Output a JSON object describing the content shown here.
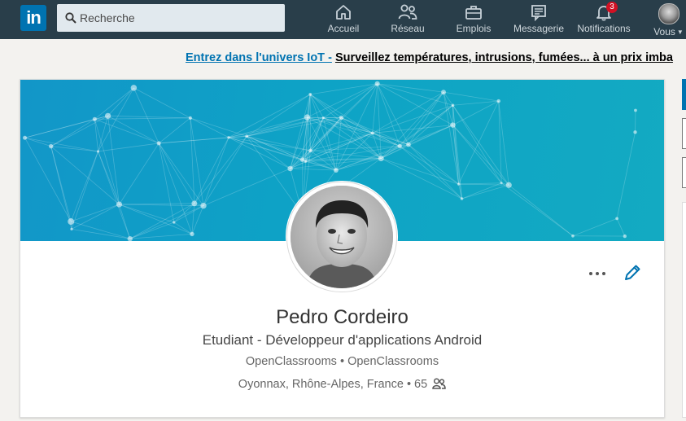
{
  "nav": {
    "logo_text": "in",
    "search": {
      "placeholder": "Recherche",
      "value": ""
    },
    "items": [
      {
        "label": "Accueil",
        "icon": "home-icon"
      },
      {
        "label": "Réseau",
        "icon": "network-icon"
      },
      {
        "label": "Emplois",
        "icon": "briefcase-icon"
      },
      {
        "label": "Messagerie",
        "icon": "messaging-icon"
      },
      {
        "label": "Notifications",
        "icon": "bell-icon",
        "badge": "3"
      },
      {
        "label": "Vous",
        "icon": "user-avatar"
      }
    ]
  },
  "ad": {
    "link_text": "Entrez dans l'univers IoT -",
    "text": "Surveillez températures, intrusions, fumées... à un prix imba"
  },
  "profile": {
    "name": "Pedro Cordeiro",
    "headline": "Etudiant - Développeur d'applications Android",
    "company": "OpenClassrooms",
    "school": "OpenClassrooms",
    "separator": "•",
    "location": "Oyonnax, Rhône-Alpes, France",
    "connections": "65"
  },
  "colors": {
    "topbar": "#293e4a",
    "brand": "#0073b1",
    "banner": "#0ea3c6",
    "badge": "#d11124"
  }
}
